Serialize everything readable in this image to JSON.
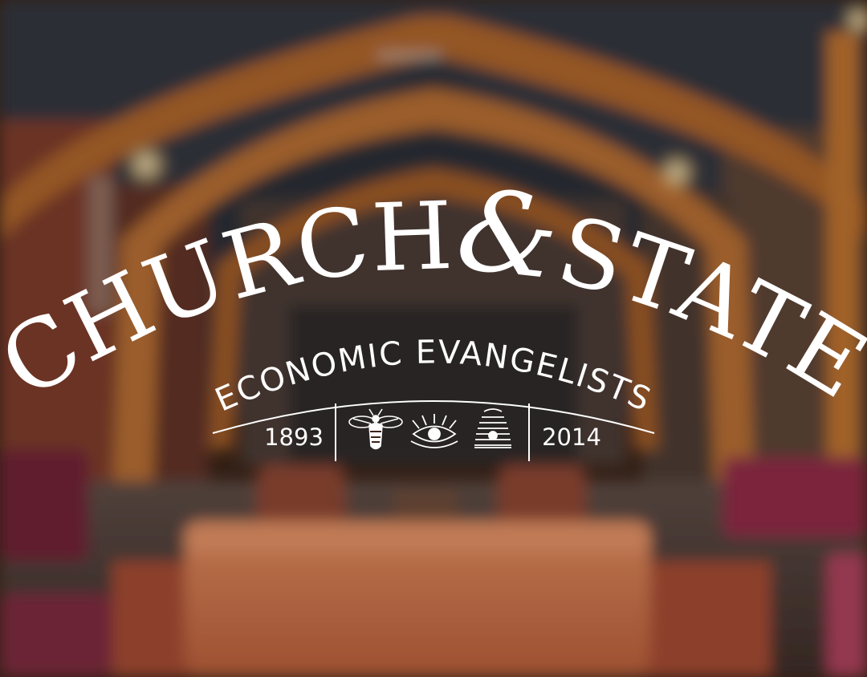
{
  "logo": {
    "word_left": "CHURCH",
    "ampersand": "&",
    "word_right": "STATE",
    "subtitle": "ECONOMIC EVANGELISTS",
    "year_start": "1893",
    "year_end": "2014"
  },
  "emblems": [
    "bee-icon",
    "eye-icon",
    "beehive-icon"
  ],
  "colors": {
    "logo_text": "#ffffff",
    "wood_beam": "#a8622a",
    "ceiling": "#2e3038",
    "sofa": "#c9704a",
    "brick": "#7a3a2c"
  }
}
